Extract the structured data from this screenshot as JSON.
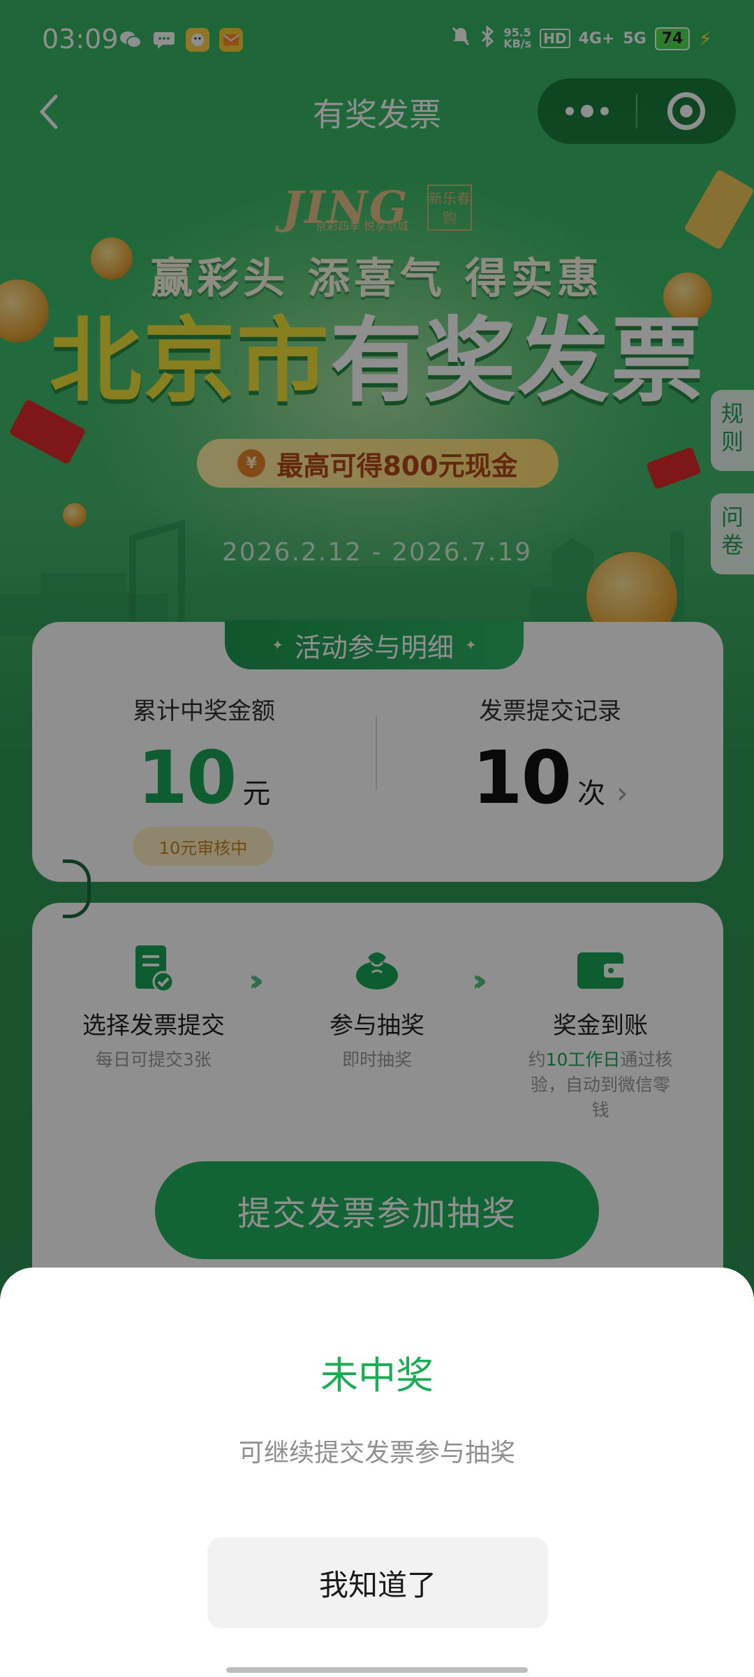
{
  "status_bar": {
    "time": "03:09",
    "net_speed_value": "95.5",
    "net_speed_unit": "KB/s",
    "hd_label": "HD",
    "signal_1": "4G+",
    "signal_2": "5G",
    "battery": "74"
  },
  "nav": {
    "title": "有奖发票",
    "back_icon": "chevron-left-icon",
    "more_icon": "more-dots-icon",
    "close_icon": "target-circle-icon"
  },
  "hero": {
    "logo_text": "JING",
    "logo_sub": "京彩四季 悦享京城",
    "logo_tag": "新乐春购",
    "slogan": "赢彩头 添喜气 得实惠",
    "headline_part1": "北京市",
    "headline_part2": "有奖发票",
    "prize_icon": "¥",
    "prize": "最高可得800元现金",
    "dates": "2026.2.12 - 2026.7.19"
  },
  "side_tabs": {
    "rules": "规则",
    "survey": "问卷"
  },
  "activity": {
    "section_title": "活动参与明细",
    "total_prize_label": "累计中奖金额",
    "total_prize_value": "10",
    "total_prize_unit": "元",
    "review_status": "10元审核中",
    "records_label": "发票提交记录",
    "records_value": "10",
    "records_unit": "次"
  },
  "steps": [
    {
      "icon": "document-check-icon",
      "title": "选择发票提交",
      "sub": "每日可提交3张"
    },
    {
      "icon": "money-bag-icon",
      "title": "参与抽奖",
      "sub": "即时抽奖"
    },
    {
      "icon": "wallet-icon",
      "title": "奖金到账",
      "sub_prefix": "约",
      "sub_highlight": "10工作日",
      "sub_rest": "通过核验，自动到微信零钱"
    }
  ],
  "submit_button": "提交发票参加抽奖",
  "dialog": {
    "title": "未中奖",
    "message": "可继续提交发票参与抽奖",
    "confirm": "我知道了"
  },
  "colors": {
    "brand_green": "#21b35f",
    "headline_yellow": "#f3e23a",
    "prize_text": "#b0481b",
    "review_text": "#c88420"
  }
}
